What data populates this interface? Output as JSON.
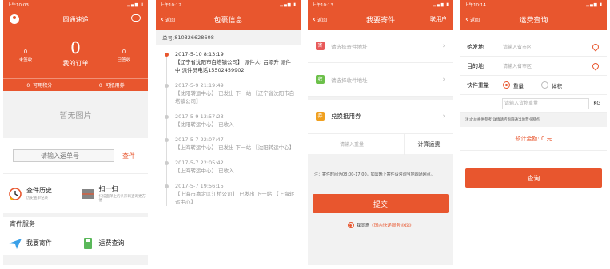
{
  "colors": {
    "accent": "#e8562e",
    "background": "#f2f2f2"
  },
  "screen1": {
    "status_time": "上午10:03",
    "title": "圆通速递",
    "stats": {
      "unsigned_count": "0",
      "unsigned_label": "未签收",
      "orders_count": "0",
      "orders_label": "我的订单",
      "signed_count": "0",
      "signed_label": "已签收"
    },
    "points": {
      "value": "0",
      "label": "可用积分"
    },
    "coupons": {
      "value": "0",
      "label": "可抵用券"
    },
    "no_image": "暂无图片",
    "tracking_placeholder": "请输入运单号",
    "search_button": "查件",
    "features": [
      {
        "title": "查件历史",
        "subtitle": "历史查单记录",
        "icon": "clock-icon"
      },
      {
        "title": "扫一扫",
        "subtitle": "扫描面单上的条形码查询更方便",
        "icon": "barcode-icon"
      }
    ],
    "section_title": "寄件服务",
    "services": [
      {
        "title": "我要寄件",
        "icon": "plane-icon"
      },
      {
        "title": "运费查询",
        "icon": "calculator-icon"
      }
    ]
  },
  "screen2": {
    "status_time": "上午10:12",
    "back": "返回",
    "title": "包裹信息",
    "order_label": "单号: ",
    "order_number": "810326628608",
    "events": [
      {
        "time": "2017-5-10 8:13:19",
        "text": "【辽宁省沈阳市白塔镇公司】 派件人: 吕添升 派件中 派件员电话15502459902"
      },
      {
        "time": "2017-5-9 21:19:49",
        "text": "【沈阳转运中心】 已发出 下一站 【辽宁省沈阳市白塔镇公司】"
      },
      {
        "time": "2017-5-9 13:57:23",
        "text": "【沈阳转运中心】 已收入"
      },
      {
        "time": "2017-5-7 22:07:47",
        "text": "【上海转运中心】 已发出 下一站 【沈阳转运中心】"
      },
      {
        "time": "2017-5-7 22:05:42",
        "text": "【上海转运中心】 已收入"
      },
      {
        "time": "2017-5-7 19:56:15",
        "text": "【上海市嘉定区江桥公司】 已发出 下一站 【上海转运中心】"
      }
    ]
  },
  "screen3": {
    "status_time": "上午10:13",
    "back": "返回",
    "title": "我要寄件",
    "right_action": "联用户",
    "sender_placeholder": "请选择寄件地址",
    "sender_badge": "寄",
    "receiver_placeholder": "请选择收件地址",
    "receiver_badge": "收",
    "coupon_label": "兑换抵用券",
    "coupon_badge": "券",
    "weight_placeholder": "请输入重量",
    "calc_button": "计算运费",
    "note": "注：寄件时间为08:00-17:00，如需晚上寄件请咨询当地圆通网点。",
    "submit": "提交",
    "agree_prefix": "我同意",
    "agree_link": "《国内快递服务协议》"
  },
  "screen4": {
    "status_time": "上午10:14",
    "back": "返回",
    "title": "运费查询",
    "origin_label": "始发地",
    "origin_placeholder": "请输入省市区",
    "dest_label": "目的地",
    "dest_placeholder": "请输入省市区",
    "weight_label": "快件重量",
    "option_weight": "重量",
    "option_volume": "体积",
    "weight_placeholder": "请输入货物重量",
    "unit": "KG",
    "fee_note": "注:此价格供参考,详情请咨询圆通当地营业网点",
    "estimate_label": "预计金额",
    "estimate_value": "0",
    "estimate_unit": "元",
    "query_button": "查询"
  }
}
